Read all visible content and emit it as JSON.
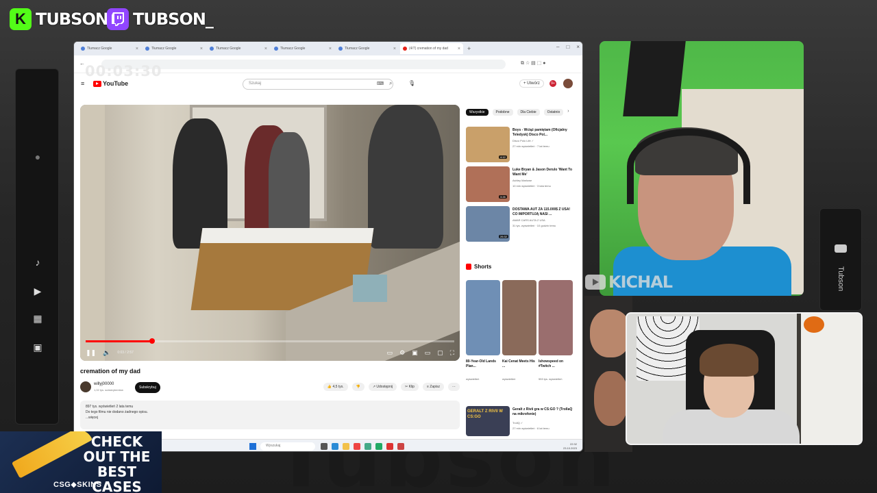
{
  "overlay": {
    "kick_name": "TUBSON",
    "twitch_name": "TUBSON_",
    "cam_label": "KICHAL",
    "right_dock_label": "Tubson",
    "watermark": "Tubson",
    "timer": "00:03:30",
    "colors": {
      "kick": "#53fc18",
      "twitch": "#9146ff",
      "youtube": "#ff0000"
    }
  },
  "ad": {
    "headline": "CHECK OUT THE BEST CASES",
    "brand": "CSG◆SKINS"
  },
  "browser": {
    "tabs": [
      {
        "label": "Tłumacz Google",
        "active": false
      },
      {
        "label": "Tłumacz Google",
        "active": false
      },
      {
        "label": "Tłumacz Google",
        "active": false
      },
      {
        "label": "Tłumacz Google",
        "active": false
      },
      {
        "label": "Tłumacz Google",
        "active": false
      },
      {
        "label": "(4/7) cremation of my dad",
        "active": true
      }
    ],
    "youtube": {
      "logo_text": "YouTube",
      "search_placeholder": "Szukaj",
      "create_label": "+ Utwórz",
      "bell_count": "9+",
      "player": {
        "time": "0:03 / 2:57",
        "progress": 0.18
      },
      "video_title": "cremation of my dad",
      "channel_name": "willyj00000",
      "channel_subs": "1,02 tys. subskrybentów",
      "subscribe_label": "Subskrybuj",
      "actions": [
        "👍 4,5 tys.",
        "👎",
        "↗ Udostępnij",
        "✂ Klip",
        "≡ Zapisz",
        "⋯"
      ],
      "description_line1": "897 tys. wyświetleń  2 lata temu",
      "description_line2": "Do tego filmu nie dodano żadnego opisu.",
      "description_more": "...więcej",
      "chips": [
        {
          "label": "Wszystkie",
          "active": true
        },
        {
          "label": "Podobne",
          "active": false
        },
        {
          "label": "Dla Ciebie",
          "active": false
        },
        {
          "label": "Ostatnio",
          "active": false
        }
      ],
      "recommendations": [
        {
          "title": "Boys - Wciąż pamiętam (Oficjalny Teledysk) Disco Pol...",
          "channel": "Disco Polo Life ✓",
          "meta": "27 mln wyświetleń · 7 lat temu",
          "duration": "4:12",
          "color": "#c9a06a"
        },
        {
          "title": "Luke Bryan & Jason Derulo 'Want To Want Me'",
          "channel": "Ashley Marlowe",
          "meta": "10 mln wyświetleń · 3 lata temu",
          "duration": "3:26",
          "color": "#b07058"
        },
        {
          "title": "DOSTAWA AUT ZA 115.000$ Z USA! CO IMPORTUJĄ NASI ...",
          "channel": "AMAR CARS AUTA Z USA",
          "meta": "31 tys. wyświetleń · 10 godzin temu",
          "duration": "26:32",
          "color": "#6c86a6"
        }
      ],
      "shorts_heading": "Shorts",
      "shorts": [
        {
          "title": "80-Year-Old Lands Plan...",
          "meta": "wyświetleń",
          "color": "#6f8fb5"
        },
        {
          "title": "Kai Cenat Meets His ...",
          "meta": "wyświetleń",
          "color": "#8a6a5a"
        },
        {
          "title": "Ishowspeed on #Twitch ...",
          "meta": "553 tys. wyświetleń",
          "color": "#9a6e6e"
        }
      ],
      "last_rec": {
        "title": "Geralt z Rivii gra w CS:GO ? (TrollaQ na mikrofonie)",
        "channel": "TrollQ ✓",
        "meta": "27 mln wyświetleń · 6 lat temu",
        "thumb_text": "GERALT Z RIVII W CS:GO"
      }
    },
    "taskbar": {
      "search_placeholder": "Wyszukaj",
      "time": "22:32",
      "date": "23.10.2023"
    }
  }
}
